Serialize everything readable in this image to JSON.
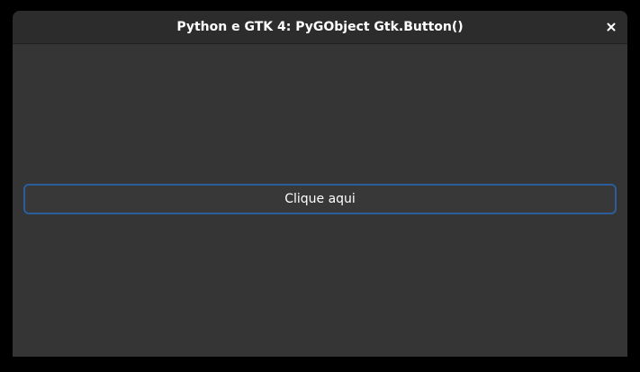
{
  "window": {
    "title": "Python e GTK 4: PyGObject Gtk.Button()"
  },
  "header": {
    "close_icon": "close-icon"
  },
  "content": {
    "button_label": "Clique aqui"
  },
  "colors": {
    "background": "#353535",
    "headerbar": "#2c2c2c",
    "focus_ring": "#2b5d9b",
    "text": "#ffffff"
  }
}
